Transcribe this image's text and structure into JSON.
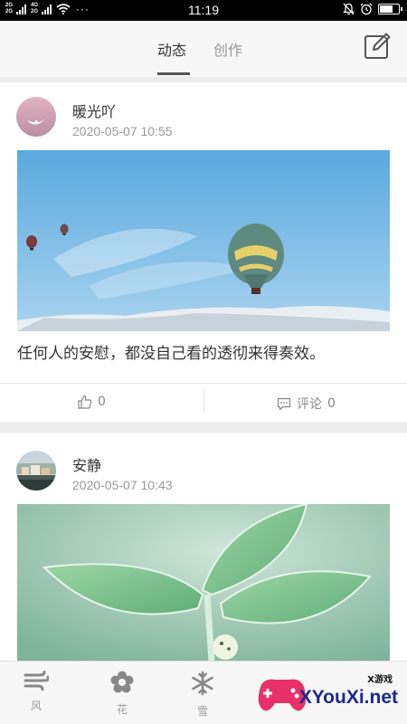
{
  "status_bar": {
    "time": "11:19",
    "sig1": "2G",
    "sig2": "4G",
    "sig3": "2G",
    "sig4": "2G",
    "dots": "···"
  },
  "top_nav": {
    "tabs": [
      {
        "label": "动态"
      },
      {
        "label": "创作"
      }
    ],
    "active_tab": 0,
    "edit_icon": "edit-icon"
  },
  "posts": [
    {
      "username": "暖光吖",
      "time": "2020-05-07 10:55",
      "image": "hot-air-balloons-over-snowy-hills",
      "caption": "任何人的安慰，都没自己看的透彻来得奏效。",
      "likes": "0",
      "comment_label": "评论",
      "comments": "0"
    },
    {
      "username": "安静",
      "time": "2020-05-07 10:43",
      "image": "green-leaves"
    }
  ],
  "bottom_nav": [
    {
      "label": "风",
      "icon": "wind-icon"
    },
    {
      "label": "花",
      "icon": "flower-icon"
    },
    {
      "label": "雪",
      "icon": "snowflake-icon"
    }
  ],
  "watermark": {
    "main": "XYouXi.net",
    "small": "X游戏"
  },
  "colors": {
    "accent": "#333333",
    "muted": "#999999",
    "sky": "#7fc0ea"
  }
}
